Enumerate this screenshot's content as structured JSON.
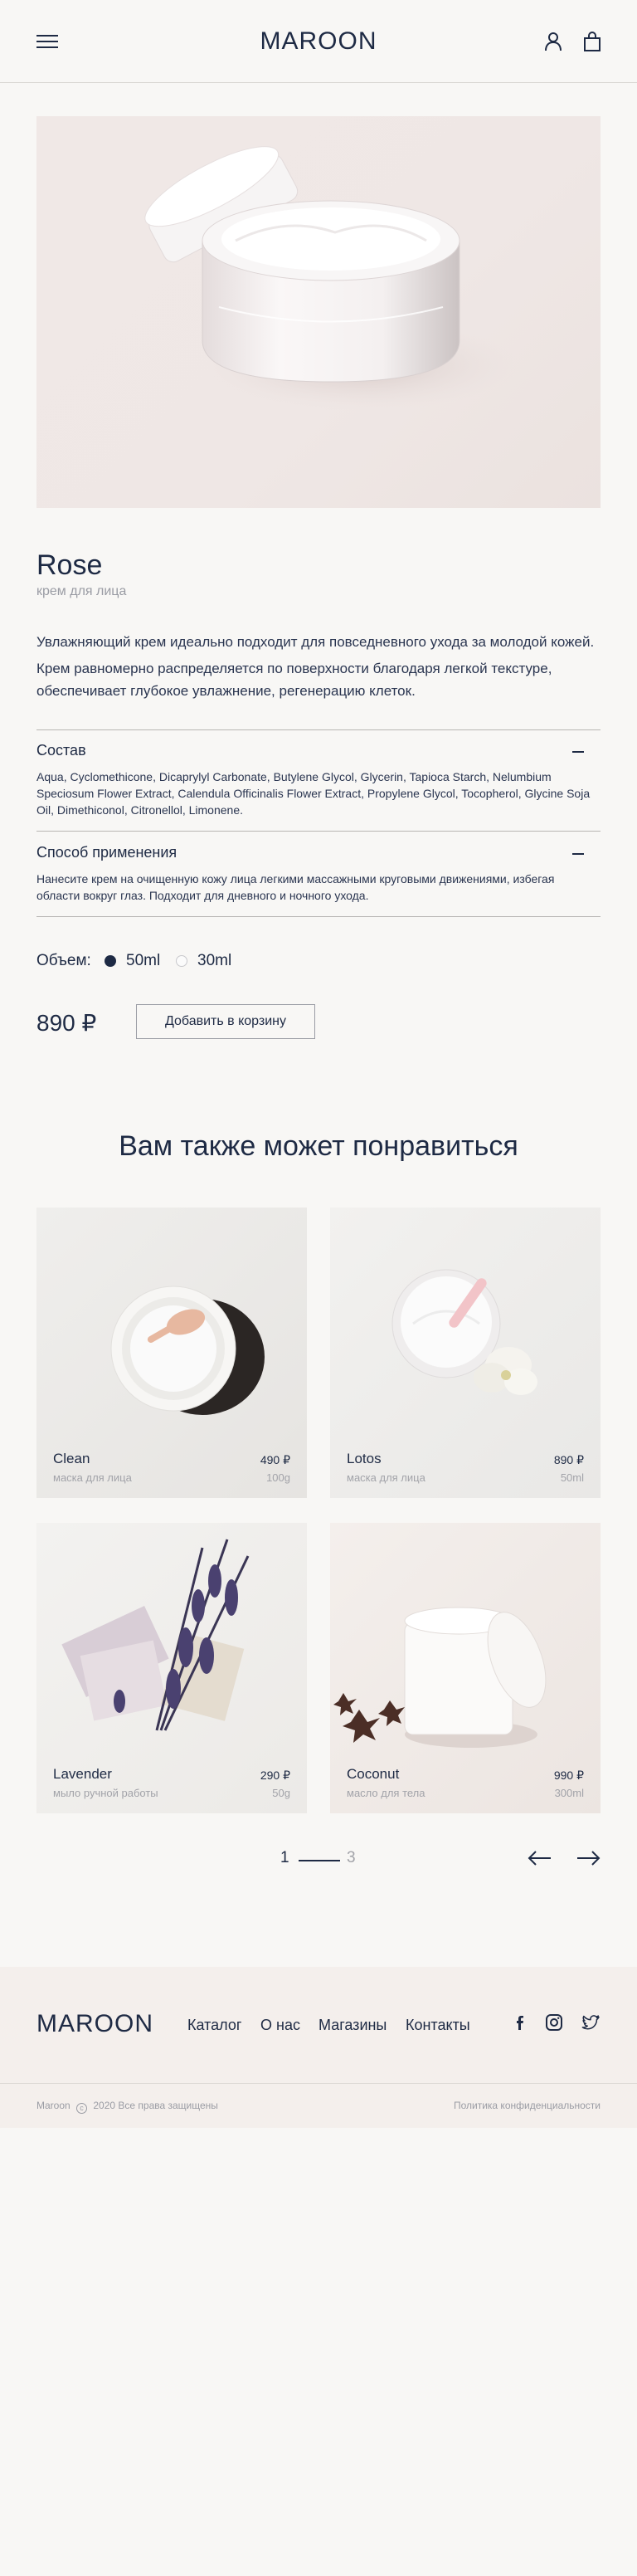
{
  "header": {
    "logo": "MAROON",
    "menu_icon": "hamburger-menu-icon",
    "user_icon": "user-icon",
    "cart_icon": "shopping-bag-icon"
  },
  "product": {
    "title": "Rose",
    "subtitle": "крем для лица",
    "description_1": "Увлажняющий крем идеально подходит для повседневного ухода за молодой кожей.",
    "description_2": "Крем равномерно распределяется по поверхности благодаря легкой текстуре, обеспечивает глубокое увлажнение, регенерацию клеток.",
    "composition_title": "Состав",
    "composition_text": "Aqua, Cyclomethicone, Dicaprylyl Carbonate, Butylene Glycol, Glycerin, Tapioca Starch, Nelumbium Speciosum Flower Extract, Calendula Officinalis Flower Extract, Propylene Glycol, Tocopherol, Glycine Soja Oil, Dimethiconol, Citronellol, Limonene.",
    "usage_title": "Способ применения",
    "usage_text": "Нанесите крем на очищенную кожу лица легкими массажными круговыми движениями, избегая области вокруг глаз. Подходит для дневного и ночного ухода.",
    "volume_label": "Объем:",
    "volume_options": [
      "50ml",
      "30ml"
    ],
    "volume_selected": "50ml",
    "price": "890 ₽",
    "add_to_cart": "Добавить в корзину"
  },
  "recommendations": {
    "title": "Вам также может понравиться",
    "items": [
      {
        "name": "Clean",
        "category": "маска для лица",
        "price": "490 ₽",
        "volume": "100g"
      },
      {
        "name": "Lotos",
        "category": "маска для лица",
        "price": "890 ₽",
        "volume": "50ml"
      },
      {
        "name": "Lavender",
        "category": "мыло ручной работы",
        "price": "290 ₽",
        "volume": "50g"
      },
      {
        "name": "Coconut",
        "category": "масло для тела",
        "price": "990 ₽",
        "volume": "300ml"
      }
    ],
    "pagination": {
      "current": "1",
      "total": "3"
    }
  },
  "footer": {
    "logo": "MAROON",
    "nav": [
      "Каталог",
      "О нас",
      "Магазины",
      "Контакты"
    ],
    "social_icons": [
      "facebook-icon",
      "instagram-icon",
      "twitter-icon"
    ],
    "copyright_brand": "Maroon",
    "copyright_text": "2020 Все права защищены",
    "privacy": "Политика конфиденциальности"
  },
  "colors": {
    "background": "#f8f7f5",
    "primary_text": "#1e2a44",
    "muted_text": "#9a9ca4",
    "footer_bg": "#f4efec"
  }
}
